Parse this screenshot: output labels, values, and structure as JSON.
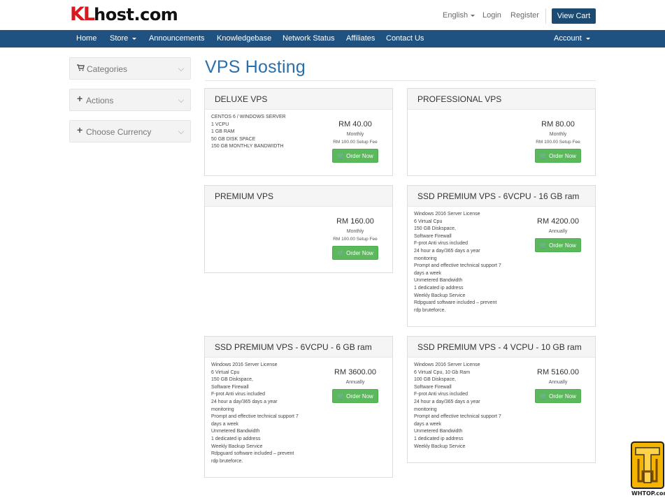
{
  "brand": {
    "logo_kl": "KL",
    "logo_rest": "host.com"
  },
  "top": {
    "language": "English",
    "login": "Login",
    "register": "Register",
    "view_cart": "View Cart"
  },
  "nav": {
    "home": "Home",
    "store": "Store",
    "announcements": "Announcements",
    "knowledgebase": "Knowledgebase",
    "network_status": "Network Status",
    "affiliates": "Affiliates",
    "contact": "Contact Us",
    "account": "Account"
  },
  "sidebar": {
    "categories": "Categories",
    "actions": "Actions",
    "currency": "Choose Currency"
  },
  "page_title": "VPS Hosting",
  "order_label": "Order Now",
  "products": [
    {
      "name": "DELUXE VPS",
      "desc": [
        "CENTOS 6 / WINDOWS SERVER",
        "1 VCPU",
        "1 GB RAM",
        "50 GB DISK SPACE",
        "150 GB MONTHLY BANDWIDTH"
      ],
      "price": "RM 40.00",
      "cycle": "Monthly",
      "setup": "RM 100.00 Setup Fee"
    },
    {
      "name": "PROFESSIONAL VPS",
      "desc": [],
      "price": "RM 80.00",
      "cycle": "Monthly",
      "setup": "RM 100.00 Setup Fee"
    },
    {
      "name": "PREMIUM VPS",
      "desc": [],
      "price": "RM 160.00",
      "cycle": "Monthly",
      "setup": "RM 100.00 Setup Fee"
    },
    {
      "name": "SSD PREMIUM VPS - 6VCPU - 16 GB ram",
      "desc": [
        "Windows 2016 Server License",
        "6 Virtual Cpu",
        "150 GB Diskspace,",
        "Software Firewall",
        "F-prot Anti virus included",
        "24 hour a day/365 days a year",
        "monitoring",
        "Prompt and effective technical support 7",
        "days a week",
        "Unmetered Bandwidth",
        "1 dedicated ip address",
        "Weekly Backup Service",
        "Rdpguard software included – prevent",
        "rdp bruteforce."
      ],
      "price": "RM 4200.00",
      "cycle": "Annually",
      "setup": ""
    },
    {
      "name": "SSD PREMIUM VPS - 6VCPU - 6 GB ram",
      "desc": [
        "Windows 2016 Server License",
        "6 Virtual Cpu",
        "150 GB Diskspace,",
        "Software Firewall",
        "F-prot Anti virus included",
        "24 hour a day/365 days a year",
        "monitoring",
        "Prompt and effective technical support 7",
        "days a week",
        "Unmetered Bandwidth",
        "1 dedicated ip address",
        "Weekly Backup Service",
        "Rdpguard software included – prevent",
        "rdp bruteforce."
      ],
      "price": "RM 3600.00",
      "cycle": "Annually",
      "setup": ""
    },
    {
      "name": "SSD PREMIUM VPS - 4 VCPU - 10 GB ram",
      "desc": [
        "Windows 2016 Server License",
        "6 Virtual Cpu, 10 Gb Ram",
        "100 GB Diskspace,",
        "Software Firewall",
        "F-prot Anti virus included",
        "24 hour a day/365 days a year",
        "monitoring",
        "Prompt and effective technical support 7",
        "days a week",
        "Unmetered Bandwidth",
        "1 dedicated ip address",
        "Weekly Backup Service"
      ],
      "price": "RM 5160.00",
      "cycle": "Annually",
      "setup": ""
    }
  ],
  "watermark": "WHTOP.com",
  "colors": {
    "nav": "#1f5280",
    "title": "#2a6fad",
    "order_button": "#5cb85c",
    "cart_button": "#1b4a72"
  }
}
